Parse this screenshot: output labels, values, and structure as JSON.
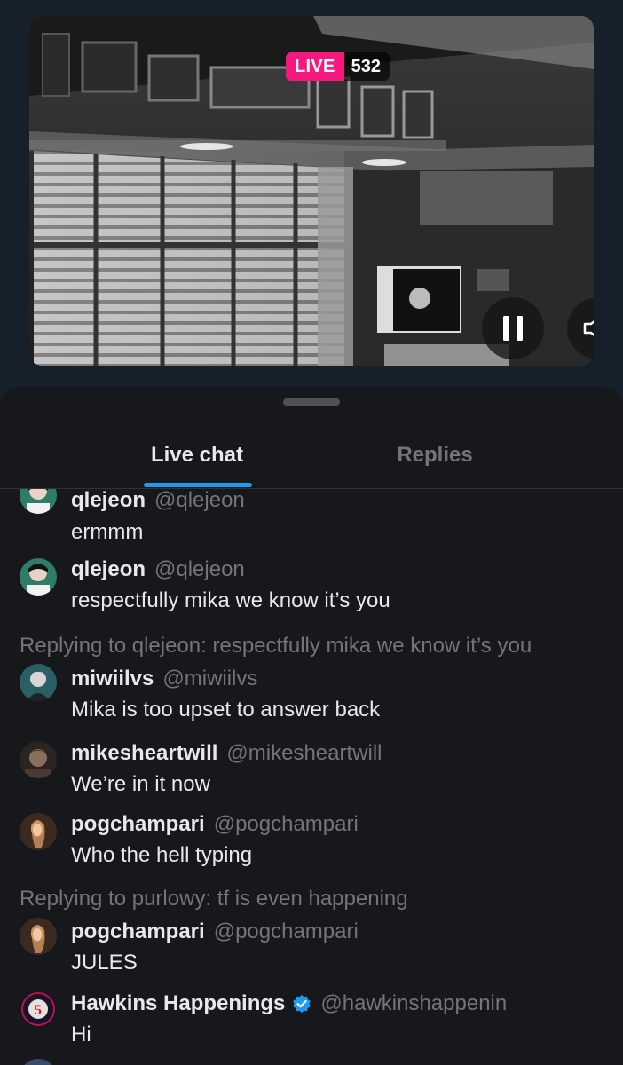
{
  "stream": {
    "live_label": "LIVE",
    "viewer_count": "532"
  },
  "controls": {
    "pause_icon": "pause-icon",
    "volume_icon": "volume-icon"
  },
  "tabs": [
    {
      "label": "Live chat",
      "active": true
    },
    {
      "label": "Replies",
      "active": false
    }
  ],
  "colors": {
    "accent": "#1d9bf0",
    "live": "#f91880",
    "background": "#16181c",
    "muted": "#71767b"
  },
  "messages": [
    {
      "name": "qlejeon",
      "handle": "@qlejeon",
      "text": "ermmm",
      "reply_to": ""
    },
    {
      "name": "qlejeon",
      "handle": "@qlejeon",
      "text": "respectfully mika we know it’s you",
      "reply_to": ""
    },
    {
      "name": "miwiilvs",
      "handle": "@miwiilvs",
      "text": "Mika is too upset to answer back",
      "reply_to": "Replying to qlejeon: respectfully mika we know it’s you"
    },
    {
      "name": "mikesheartwill",
      "handle": "@mikesheartwill",
      "text": "We’re in it now",
      "reply_to": ""
    },
    {
      "name": "pogchampari",
      "handle": "@pogchampari",
      "text": "Who the hell typing",
      "reply_to": ""
    },
    {
      "name": "pogchampari",
      "handle": "@pogchampari",
      "text": "JULES",
      "reply_to": "Replying to purlowy: tf is even happening"
    },
    {
      "name": "Hawkins Happenings",
      "handle": "@hawkinshappenin",
      "text": "Hi",
      "reply_to": "",
      "verified": true
    }
  ]
}
